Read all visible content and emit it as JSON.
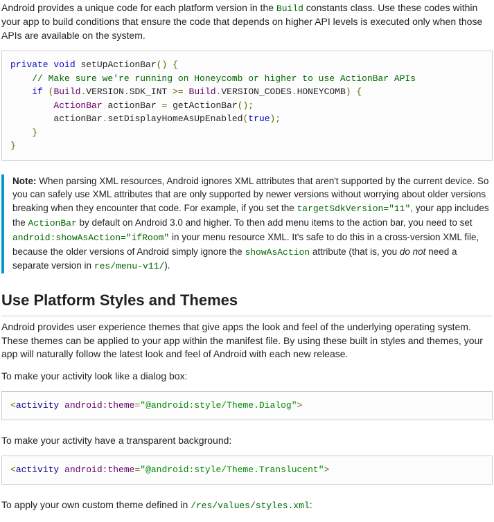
{
  "intro": {
    "pre": "Android provides a unique code for each platform version in the ",
    "code": "Build",
    "post": " constants class. Use these codes within your app to build conditions that ensure the code that depends on higher API levels is executed only when those APIs are available on the system."
  },
  "code1": {
    "l1_kw1": "private",
    "l1_kw2": "void",
    "l1_fn": " setUpActionBar",
    "l1_p": "()",
    "l1_b": " {",
    "l2": "    // Make sure we're running on Honeycomb or higher to use ActionBar APIs",
    "l3_kw": "if",
    "l3_p1": " (",
    "l3_t1": "Build",
    "l3_m1": ".",
    "l3_v1": "VERSION",
    "l3_m2": ".",
    "l3_v2": "SDK_INT ",
    "l3_op": ">=",
    "l3_t2": " Build",
    "l3_m3": ".",
    "l3_v3": "VERSION_CODES",
    "l3_m4": ".",
    "l3_v4": "HONEYCOMB",
    "l3_p2": ")",
    "l3_b": " {",
    "l4_t": "ActionBar",
    "l4_rest": " actionBar ",
    "l4_eq": "=",
    "l4_call": " getActionBar",
    "l4_p": "();",
    "l5_a": "        actionBar",
    "l5_d": ".",
    "l5_m": "setDisplayHomeAsUpEnabled",
    "l5_p1": "(",
    "l5_kw": "true",
    "l5_p2": ");",
    "l6": "    }",
    "l7": "}"
  },
  "note": {
    "label": "Note:",
    "s1": " When parsing XML resources, Android ignores XML attributes that aren't supported by the current device. So you can safely use XML attributes that are only supported by newer versions without worrying about older versions breaking when they encounter that code. For example, if you set the ",
    "c1": "targetSdkVersion=\"11\"",
    "s2": ", your app includes the ",
    "c2": "ActionBar",
    "s3": " by default on Android 3.0 and higher. To then add menu items to the action bar, you need to set ",
    "c3": "android:showAsAction=\"ifRoom\"",
    "s4": " in your menu resource XML. It's safe to do this in a cross-version XML file, because the older versions of Android simply ignore the ",
    "c4": "showAsAction",
    "s5": " attribute (that is, you ",
    "em": "do not",
    "s6": " need a separate version in ",
    "c5": "res/menu-v11/",
    "s7": ")."
  },
  "heading": "Use Platform Styles and Themes",
  "p2": "Android provides user experience themes that give apps the look and feel of the underlying operating system. These themes can be applied to your app within the manifest file. By using these built in styles and themes, your app will naturally follow the latest look and feel of Android with each new release.",
  "p3": "To make your activity look like a dialog box:",
  "code2": {
    "open": "<",
    "tag": "activity",
    "attr": " android:theme",
    "eq": "=",
    "val": "\"@android:style/Theme.Dialog\"",
    "close": ">"
  },
  "p4": "To make your activity have a transparent background:",
  "code3": {
    "open": "<",
    "tag": "activity",
    "attr": " android:theme",
    "eq": "=",
    "val": "\"@android:style/Theme.Translucent\"",
    "close": ">"
  },
  "p5": {
    "pre": "To apply your own custom theme defined in ",
    "code": "/res/values/styles.xml",
    "post": ":"
  }
}
